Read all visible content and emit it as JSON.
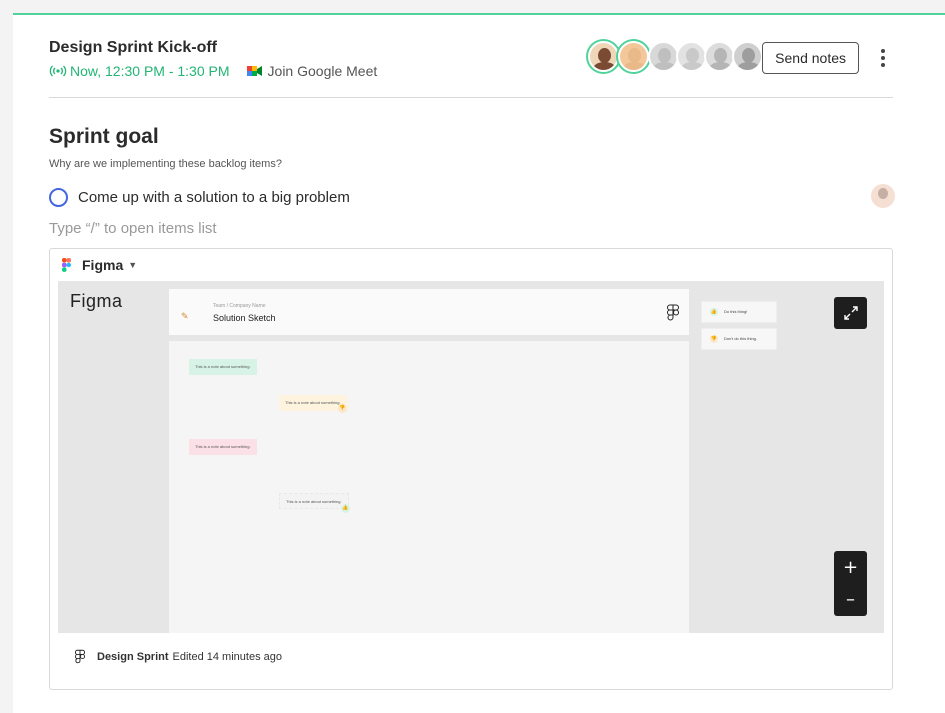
{
  "meeting": {
    "title": "Design Sprint Kick-off",
    "time": "Now, 12:30 PM - 1:30 PM",
    "meet_link": "Join Google Meet",
    "send_notes": "Send notes"
  },
  "attendees": [
    {
      "skin": "#7a4a32",
      "bg": "#f0d6b8",
      "active": true
    },
    {
      "skin": "#e9b98a",
      "bg": "#f3c79a",
      "active": true
    },
    {
      "skin": "#bfbfbf",
      "bg": "#d8d8d8",
      "active": false
    },
    {
      "skin": "#c9c9c9",
      "bg": "#e2e2e2",
      "active": false
    },
    {
      "skin": "#b5b5b5",
      "bg": "#dcdcdc",
      "active": false
    },
    {
      "skin": "#9e9e9e",
      "bg": "#cfcfcf",
      "active": false
    }
  ],
  "section": {
    "title": "Sprint goal",
    "subtitle": "Why are we implementing these backlog items?",
    "task": "Come up with a solution to a big problem",
    "placeholder": "Type “/” to open items list"
  },
  "embed": {
    "source": "Figma",
    "canvas": {
      "wordmark": "Figma",
      "crumb": "Team / Company Name",
      "frame_title": "Solution Sketch",
      "stickies": [
        {
          "text": "This is a note about something.",
          "color": "#d7f3e6"
        },
        {
          "text": "This is a note about something.",
          "color": "#fdf3de"
        },
        {
          "text": "This is a note about something.",
          "color": "#fbe0e6"
        },
        {
          "text": "This is a note about something.",
          "color": "#f3f3f3"
        }
      ],
      "side_items": [
        "Do this thing!",
        "Don't do this thing."
      ]
    },
    "file_name": "Design Sprint",
    "edited": "Edited 14 minutes ago",
    "zoom_in": "+",
    "zoom_out": "–"
  }
}
